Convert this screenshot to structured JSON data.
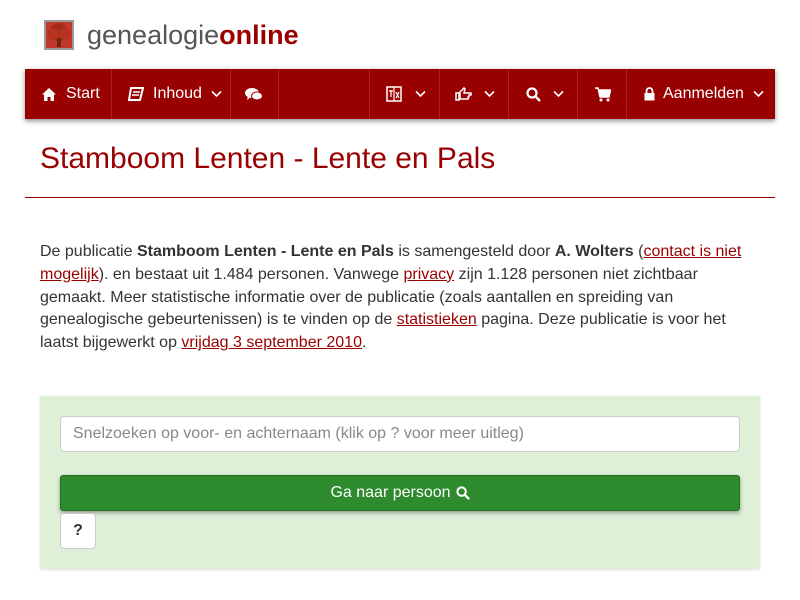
{
  "brand": {
    "name_part1": "genealogie",
    "name_part2": "online",
    "logo_icon": "tree-icon"
  },
  "nav": {
    "start_label": "Start",
    "inhoud_label": "Inhoud",
    "login_label": "Aanmelden",
    "icons": [
      "home-icon",
      "book-icon",
      "comments-icon",
      "language-icon",
      "hand-point-icon",
      "search-icon",
      "cart-icon",
      "lock-icon"
    ]
  },
  "page": {
    "title": "Stamboom Lenten - Lente en Pals"
  },
  "intro": {
    "t1": "De publicatie ",
    "pub_name": "Stamboom Lenten - Lente en Pals",
    "t2": " is samengesteld door ",
    "author": "A. Wolters",
    "t3": " (",
    "contact_link": "contact is niet mogelijk",
    "t4": "). en bestaat uit 1.484 personen. Vanwege ",
    "privacy_link": "privacy",
    "t5": " zijn 1.128 personen niet zichtbaar gemaakt. Meer statistische informatie over de publicatie (zoals aantallen en spreiding van genealogische gebeurtenissen) is te vinden op de ",
    "stats_link": "statistieken",
    "t6": " pagina. Deze publicatie is voor het laatst bijgewerkt op ",
    "date_link": "vrijdag 3 september 2010",
    "t7": "."
  },
  "search": {
    "placeholder": "Snelzoeken op voor- en achternaam (klik op ? voor meer uitleg)",
    "value": "",
    "button_label": "Ga naar persoon",
    "help_label": "?"
  },
  "colors": {
    "brand_red": "#990000",
    "panel_green": "#dff0d8",
    "button_green": "#2d8a2d"
  }
}
